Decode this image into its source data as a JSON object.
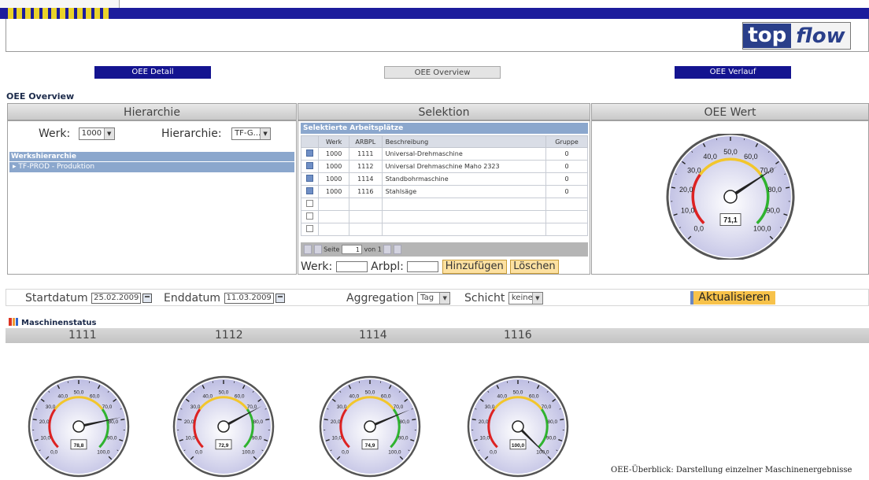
{
  "logo": {
    "part1": "top",
    "part2": "flow"
  },
  "nav": {
    "detail": "OEE Detail",
    "overview": "OEE Overview",
    "verlauf": "OEE Verlauf"
  },
  "section_title": "OEE Overview",
  "panels": {
    "hierarchie": "Hierarchie",
    "selektion": "Selektion",
    "oee_wert": "OEE Wert"
  },
  "hierarchie": {
    "werk_label": "Werk:",
    "werk_value": "1000",
    "hier_label": "Hierarchie:",
    "hier_value": "TF-G...",
    "tree_header": "Werkshierarchie",
    "tree_item": "TF-PROD - Produktion"
  },
  "selektion": {
    "title": "Selektierte Arbeitsplätze",
    "columns": [
      "Werk",
      "ARBPL",
      "Beschreibung",
      "Gruppe"
    ],
    "rows": [
      [
        "1000",
        "1111",
        "Universal-Drehmaschine",
        "0"
      ],
      [
        "1000",
        "1112",
        "Universal Drehmaschine Maho 2323",
        "0"
      ],
      [
        "1000",
        "1114",
        "Standbohrmaschine",
        "0"
      ],
      [
        "1000",
        "1116",
        "Stahlsäge",
        "0"
      ]
    ],
    "empty_rows": 3,
    "pager": {
      "seite": "Seite",
      "page": "1",
      "von": "von 1"
    },
    "werk_label": "Werk:",
    "arbpl_label": "Arbpl:",
    "add_button": "Hinzufügen",
    "delete_button": "Löschen"
  },
  "main_gauge": {
    "value": 71.1,
    "display": "71,1",
    "ticks": [
      "0,0",
      "10,0",
      "20,0",
      "30,0",
      "40,0",
      "50,0",
      "60,0",
      "70,0",
      "80,0",
      "90,0",
      "100,0"
    ]
  },
  "filters": {
    "start_label": "Startdatum",
    "start_value": "25.02.2009",
    "end_label": "Enddatum",
    "end_value": "11.03.2009",
    "agg_label": "Aggregation",
    "agg_value": "Tag",
    "schicht_label": "Schicht",
    "schicht_value": "keine",
    "refresh": "Aktualisieren"
  },
  "machine_status": {
    "title": "Maschinenstatus",
    "machines": [
      {
        "id": "1111",
        "value": 78.8,
        "display": "78,8"
      },
      {
        "id": "1112",
        "value": 72.9,
        "display": "72,9"
      },
      {
        "id": "1114",
        "value": 74.9,
        "display": "74,9"
      },
      {
        "id": "1116",
        "value": 100.0,
        "display": "100,0"
      }
    ]
  },
  "colors": {
    "nav_blue": "#141490",
    "header_blue": "#8ba7cd",
    "button_yellow": "#fde1a1",
    "gauge_red": "#dd2222",
    "gauge_yellow": "#f2c62c",
    "gauge_green": "#2fb32f"
  },
  "caption": "OEE-Überblick: Darstellung einzelner Maschinenergebnisse"
}
